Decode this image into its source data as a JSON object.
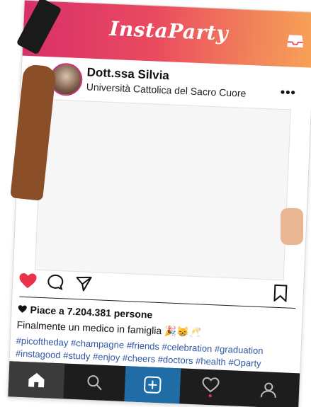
{
  "header": {
    "logo": "InstaParty",
    "inbox_icon": "inbox-icon"
  },
  "profile": {
    "username": "Dott.ssa Silvia",
    "subtitle": "Università Cattolica del Sacro Cuore",
    "more_icon": "more-options-icon",
    "more_glyph": "•••"
  },
  "actions": {
    "like_icon": "heart-icon",
    "comment_icon": "comment-icon",
    "send_icon": "send-icon",
    "save_icon": "bookmark-icon",
    "like_color": "#e8334a"
  },
  "post": {
    "likes_text": "Piace a 7.204.381 persone",
    "caption": "Finalmente un medico in famiglia 🎉😸🥂",
    "hashtags": "#picoftheday #champagne #friends #celebration #graduation #instagood #study #enjoy #cheers #doctors #health #Oparty"
  },
  "navbar": {
    "items": [
      "home-icon",
      "search-icon",
      "add-post-icon",
      "activity-icon",
      "profile-icon"
    ],
    "active_color": "#1f6ca7"
  },
  "colors": {
    "gradient_start": "#d8306a",
    "gradient_end": "#f7a257",
    "hashtag": "#2f57a6",
    "navbar_bg": "#1d1d1d"
  }
}
